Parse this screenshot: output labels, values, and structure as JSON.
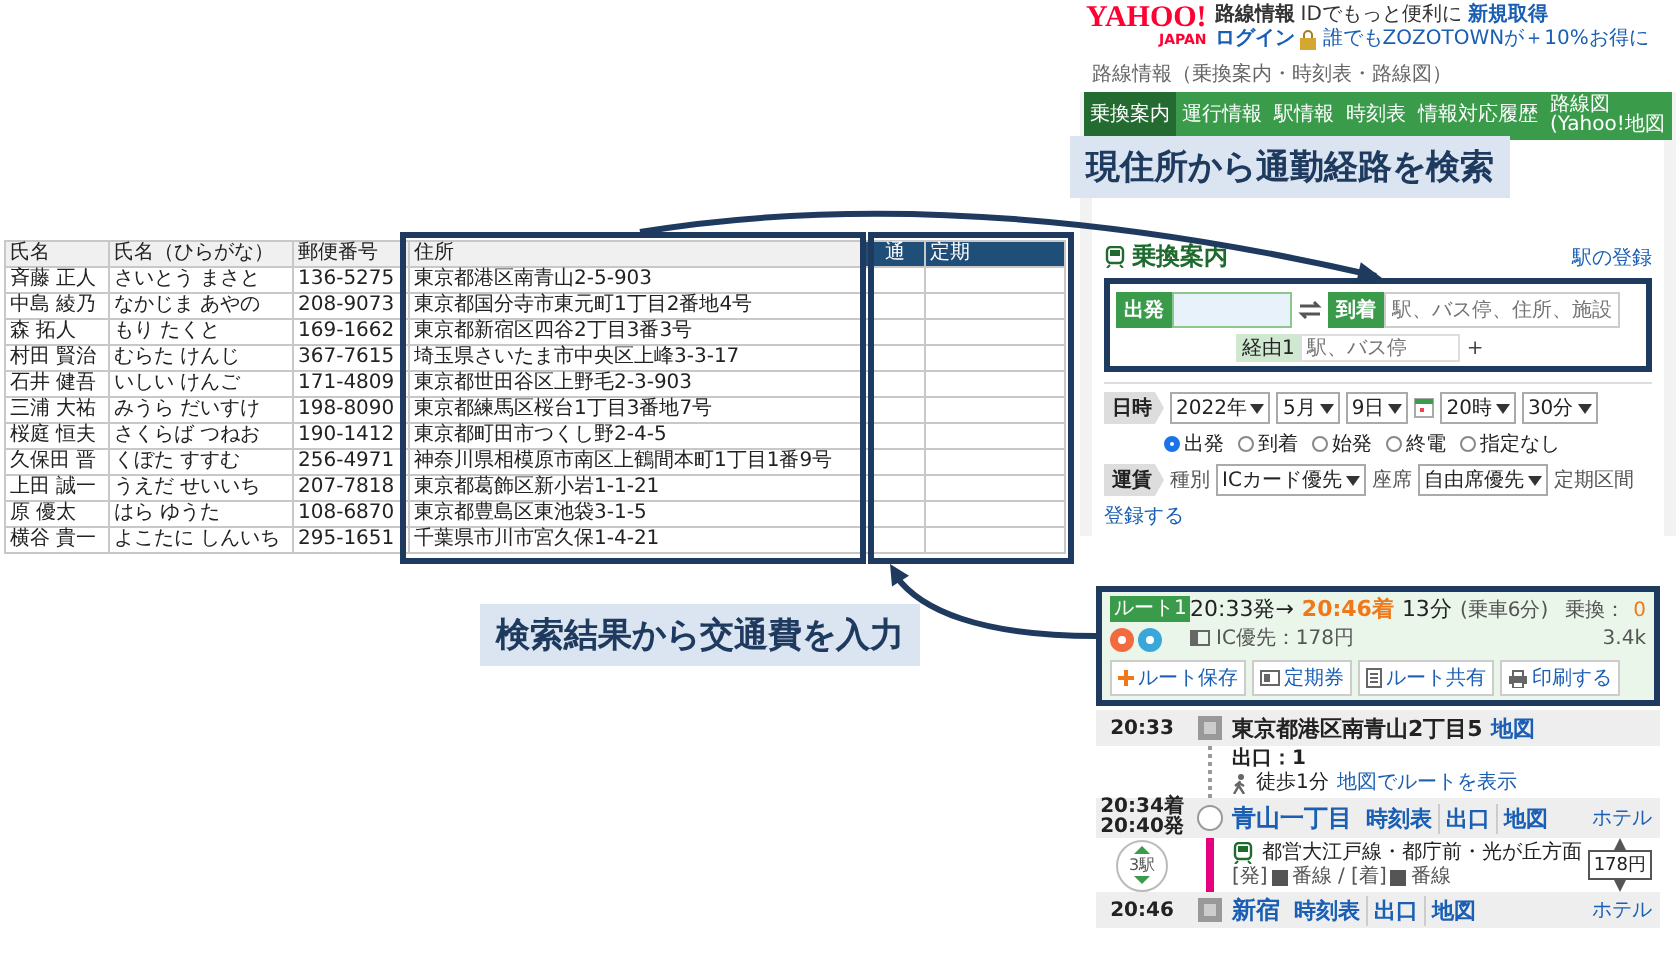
{
  "spreadsheet": {
    "columns": [
      {
        "label": "氏名",
        "highlighted": false
      },
      {
        "label": "氏名（ひらがな）",
        "highlighted": false
      },
      {
        "label": "郵便番号",
        "highlighted": false
      },
      {
        "label": "住所",
        "highlighted": false
      },
      {
        "label": "通",
        "highlighted": true
      },
      {
        "label": "定期",
        "highlighted": true
      }
    ],
    "rows": [
      {
        "cells": [
          "斉藤 正人",
          "さいとう まさと",
          "136-5275",
          "東京都港区南青山2-5-903"
        ]
      },
      {
        "cells": [
          "中島 綾乃",
          "なかじま あやの",
          "208-9073",
          "東京都国分寺市東元町1丁目2番地4号"
        ]
      },
      {
        "cells": [
          "森 拓人",
          "もり たくと",
          "169-1662",
          "東京都新宿区四谷2丁目3番3号"
        ]
      },
      {
        "cells": [
          "村田 賢治",
          "むらた けんじ",
          "367-7615",
          "埼玉県さいたま市中央区上峰3-3-17"
        ]
      },
      {
        "cells": [
          "石井 健吾",
          "いしい けんご",
          "171-4809",
          "東京都世田谷区上野毛2-3-903"
        ]
      },
      {
        "cells": [
          "三浦 大祐",
          "みうら だいすけ",
          "198-8090",
          "東京都練馬区桜台1丁目3番地7号"
        ]
      },
      {
        "cells": [
          "桜庭 恒夫",
          "さくらば つねお",
          "190-1412",
          "東京都町田市つくし野2-4-5"
        ]
      },
      {
        "cells": [
          "久保田 晋",
          "くぼた すすむ",
          "256-4971",
          "神奈川県相模原市南区上鶴間本町1丁目1番9号"
        ]
      },
      {
        "cells": [
          "上田 誠一",
          "うえだ せいいち",
          "207-7818",
          "東京都葛飾区新小岩1-1-21"
        ]
      },
      {
        "cells": [
          "原 優太",
          "はら ゆうた",
          "108-6870",
          "東京都豊島区東池袋3-1-5"
        ]
      },
      {
        "cells": [
          "横谷 貴一",
          "よこたに しんいち",
          "295-1651",
          "千葉県市川市宮久保1-4-21"
        ]
      }
    ]
  },
  "callouts": [
    {
      "text": "現住所から通勤経路を検索"
    },
    {
      "text": "検索結果から交通費を入力"
    }
  ],
  "route_search": {
    "logo": "YAHOO!",
    "logo_sub": "JAPAN",
    "service": "路線情報",
    "id_prompt": "IDでもっと便利に",
    "signup_link": "新規取得",
    "login_link": "ログイン",
    "promo": "誰でもZOZOTOWNが＋10%お得に",
    "breadcrumb": "路線情報（乗換案内・時刻表・路線図）",
    "nav": [
      {
        "label": "乗換案内",
        "selected": true
      },
      {
        "label": "運行情報",
        "selected": false
      },
      {
        "label": "駅情報",
        "selected": false
      },
      {
        "label": "時刻表",
        "selected": false
      },
      {
        "label": "情報対応履歴",
        "selected": false
      },
      {
        "label": "路線図(Yahoo!地図",
        "selected": false
      }
    ],
    "title": "乗換案内",
    "register_link": "駅の登録",
    "from_label": "出発",
    "to_label": "到着",
    "to_placeholder": "駅、バス停、住所、施設",
    "via_label": "経由1",
    "via_placeholder": "駅、バス停",
    "add_via": "+",
    "date_label": "日時",
    "date_selects": [
      "2022年",
      "5月",
      "9日"
    ],
    "time_selects": [
      "20時",
      "30分"
    ],
    "time_modes": [
      {
        "label": "出発",
        "selected": true
      },
      {
        "label": "到着",
        "selected": false
      },
      {
        "label": "始発",
        "selected": false
      },
      {
        "label": "終電",
        "selected": false
      },
      {
        "label": "指定なし",
        "selected": false
      }
    ],
    "fare_label": "運賃",
    "type_label": "種別",
    "type_value": "ICカード優先",
    "seat_label": "座席",
    "seat_value": "自由席優先",
    "commuter_label": "定期区間",
    "commuter_link": "登録する"
  },
  "route_result": {
    "route_label": "ルート1",
    "departure": "20:33発→",
    "arrival": "20:46着",
    "duration": "13分",
    "ride_time": "(乗車6分)",
    "transfer_label": "乗換：",
    "transfer_count": "0",
    "fare": "IC優先：178円",
    "distance": "3.4k",
    "actions": [
      {
        "label": "ルート保存",
        "kind": "save"
      },
      {
        "label": "定期券",
        "kind": "pass"
      },
      {
        "label": "ルート共有",
        "kind": "share"
      },
      {
        "label": "印刷する",
        "kind": "print"
      }
    ],
    "start": {
      "time": "20:33",
      "name": "東京都港区南青山2丁目5",
      "map_link": "地図"
    },
    "walk": {
      "exit": "出口：1",
      "duration": "徒歩1分",
      "map_route_link": "地図でルートを表示"
    },
    "transfer_station": {
      "arrival": "20:34着",
      "departure": "20:40発",
      "name": "青山一丁目",
      "links": [
        "時刻表",
        "出口",
        "地図"
      ],
      "hotel_link": "ホテル"
    },
    "ride": {
      "stops": "3駅",
      "line": "都営大江戸線・都庁前・光が丘方面",
      "dep_label": "[発]",
      "middle": "番線 / [着]",
      "end": "番線",
      "fare": "178円"
    },
    "end": {
      "time": "20:46",
      "name": "新宿",
      "links": [
        "時刻表",
        "出口",
        "地図"
      ],
      "hotel_link": "ホテル"
    }
  }
}
